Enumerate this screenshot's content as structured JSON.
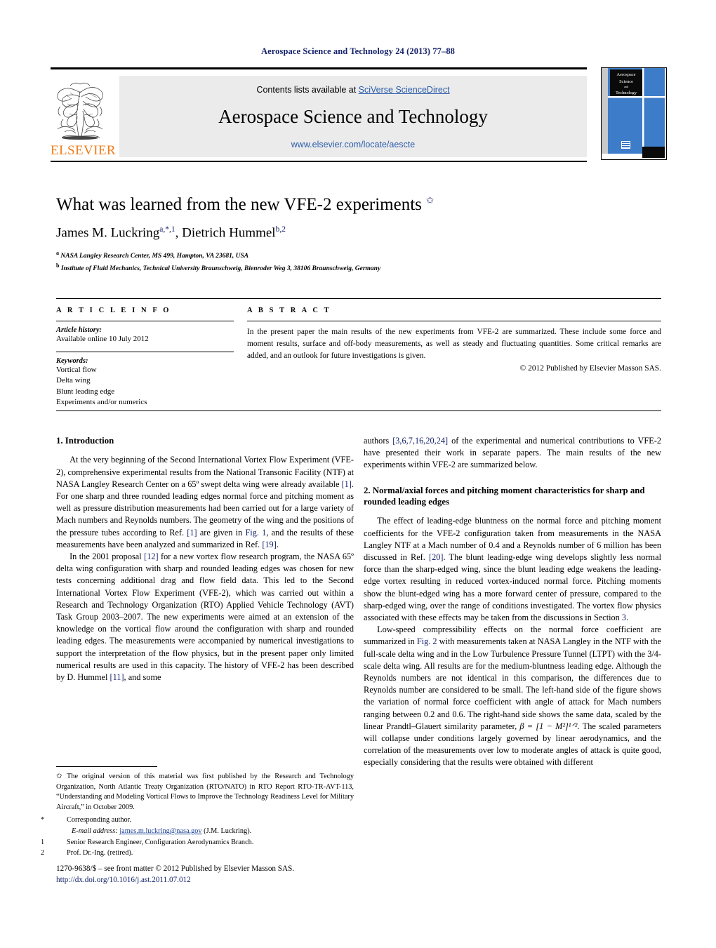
{
  "running_head": "Aerospace Science and Technology 24 (2013) 77–88",
  "masthead": {
    "contents_prefix": "Contents lists available at ",
    "contents_link": "SciVerse ScienceDirect",
    "journal_title": "Aerospace Science and Technology",
    "journal_url": "www.elsevier.com/locate/aescte",
    "publisher_wordmark": "ELSEVIER",
    "cover_title_lines": [
      "Aerospace",
      "Science",
      "and",
      "Technology"
    ]
  },
  "article": {
    "title": "What was learned from the new VFE-2 experiments",
    "title_marker": "✩",
    "authors": "James M. Luckring",
    "author1_marks": "a,*,1",
    "authors_sep": ", ",
    "author2": "Dietrich Hummel",
    "author2_marks": "b,2",
    "affiliation_a_mark": "a",
    "affiliation_a": "NASA Langley Research Center, MS 499, Hampton, VA 23681, USA",
    "affiliation_b_mark": "b",
    "affiliation_b": "Institute of Fluid Mechanics, Technical University Braunschweig, Bienroder Weg 3, 38106 Braunschweig, Germany"
  },
  "article_info": {
    "heading": "A R T I C L E    I N F O",
    "history_label": "Article history:",
    "history_value": "Available online 10 July 2012",
    "keywords_label": "Keywords:",
    "keywords": [
      "Vortical flow",
      "Delta wing",
      "Blunt leading edge",
      "Experiments and/or numerics"
    ]
  },
  "abstract": {
    "heading": "A B S T R A C T",
    "text": "In the present paper the main results of the new experiments from VFE-2 are summarized. These include some force and moment results, surface and off-body measurements, as well as steady and fluctuating quantities. Some critical remarks are added, and an outlook for future investigations is given.",
    "copyright": "© 2012 Published by Elsevier Masson SAS."
  },
  "body": {
    "left": {
      "section1_heading": "1. Introduction",
      "para1_a": "At the very beginning of the Second International Vortex Flow Experiment (VFE-2), comprehensive experimental results from the National Transonic Facility (NTF) at NASA Langley Research Center on a 65º swept delta wing were already available ",
      "para1_ref1": "[1]",
      "para1_b": ". For one sharp and three rounded leading edges normal force and pitching moment as well as pressure distribution measurements had been carried out for a large variety of Mach numbers and Reynolds numbers. The geometry of the wing and the positions of the pressure tubes according to Ref. ",
      "para1_ref2": "[1]",
      "para1_c": " are given in ",
      "para1_ref3": "Fig. 1",
      "para1_d": ", and the results of these measurements have been analyzed and summarized in Ref. ",
      "para1_ref4": "[19]",
      "para1_e": ".",
      "para2_a": "In the 2001 proposal ",
      "para2_ref1": "[12]",
      "para2_b": " for a new vortex flow research program, the NASA 65º delta wing configuration with sharp and rounded leading edges was chosen for new tests concerning additional drag and flow field data. This led to the Second International Vortex Flow Experiment (VFE-2), which was carried out within a Research and Technology Organization (RTO) Applied Vehicle Technology (AVT) Task Group 2003–2007. The new experiments were aimed at an extension of the knowledge on the vortical flow around the configuration with sharp and rounded leading edges. The measurements were accompanied by numerical investigations to support the interpretation of the flow physics, but in the present paper only limited numerical results are used in this capacity. The history of VFE-2 has been described by D. Hummel ",
      "para2_ref2": "[11]",
      "para2_c": ", and some"
    },
    "right": {
      "para3_a": "authors ",
      "para3_ref1": "[3,6,7,16,20,24]",
      "para3_b": " of the experimental and numerical contributions to VFE-2 have presented their work in separate papers. The main results of the new experiments within VFE-2 are summarized below.",
      "section2_heading": "2. Normal/axial forces and pitching moment characteristics for sharp and rounded leading edges",
      "para4_a": "The effect of leading-edge bluntness on the normal force and pitching moment coefficients for the VFE-2 configuration taken from measurements in the NASA Langley NTF at a Mach number of 0.4 and a Reynolds number of 6 million has been discussed in Ref. ",
      "para4_ref1": "[20]",
      "para4_b": ". The blunt leading-edge wing develops slightly less normal force than the sharp-edged wing, since the blunt leading edge weakens the leading-edge vortex resulting in reduced vortex-induced normal force. Pitching moments show the blunt-edged wing has a more forward center of pressure, compared to the sharp-edged wing, over the range of conditions investigated. The vortex flow physics associated with these effects may be taken from the discussions in Section ",
      "para4_ref2": "3",
      "para4_c": ".",
      "para5_a": "Low-speed compressibility effects on the normal force coefficient are summarized in ",
      "para5_ref1": "Fig. 2",
      "para5_b": " with measurements taken at NASA Langley in the NTF with the full-scale delta wing and in the Low Turbulence Pressure Tunnel (LTPT) with the 3/4-scale delta wing. All results are for the medium-bluntness leading edge. Although the Reynolds numbers are not identical in this comparison, the differences due to Reynolds number are considered to be small. The left-hand side of the figure shows the variation of normal force coefficient with angle of attack for Mach numbers ranging between 0.2 and 0.6. The right-hand side shows the same data, scaled by the linear Prandtl–Glauert similarity parameter, ",
      "para5_formula": "β = [1 − M²]¹ᐟ²",
      "para5_c": ". The scaled parameters will collapse under conditions largely governed by linear aerodynamics, and the correlation of the measurements over low to moderate angles of attack is quite good, especially considering that the results were obtained with different"
    }
  },
  "footnotes": {
    "star_mark": "✩",
    "star_text": "The original version of this material was first published by the Research and Technology Organization, North Atlantic Treaty Organization (RTO/NATO) in RTO Report RTO-TR-AVT-113, “Understanding and Modeling Vortical Flows to Improve the Technology Readiness Level for Military Aircraft,” in October 2009.",
    "corresponding_mark": "*",
    "corresponding_text": "Corresponding author.",
    "email_label": "E-mail address:",
    "email_address": "james.m.luckring@nasa.gov",
    "email_owner": "(J.M. Luckring).",
    "note1_mark": "1",
    "note1_text": "Senior Research Engineer, Configuration Aerodynamics Branch.",
    "note2_mark": "2",
    "note2_text": "Prof. Dr.-Ing. (retired)."
  },
  "footer": {
    "issn_line": "1270-9638/$ – see front matter  © 2012 Published by Elsevier Masson SAS.",
    "doi": "http://dx.doi.org/10.1016/j.ast.2011.07.012"
  },
  "colors": {
    "link_blue": "#2a5caa",
    "ref_blue": "#16226b",
    "elsevier_orange": "#f07d1a",
    "cover_blue": "#3d7cc9",
    "banner_gray": "#ebebeb"
  }
}
